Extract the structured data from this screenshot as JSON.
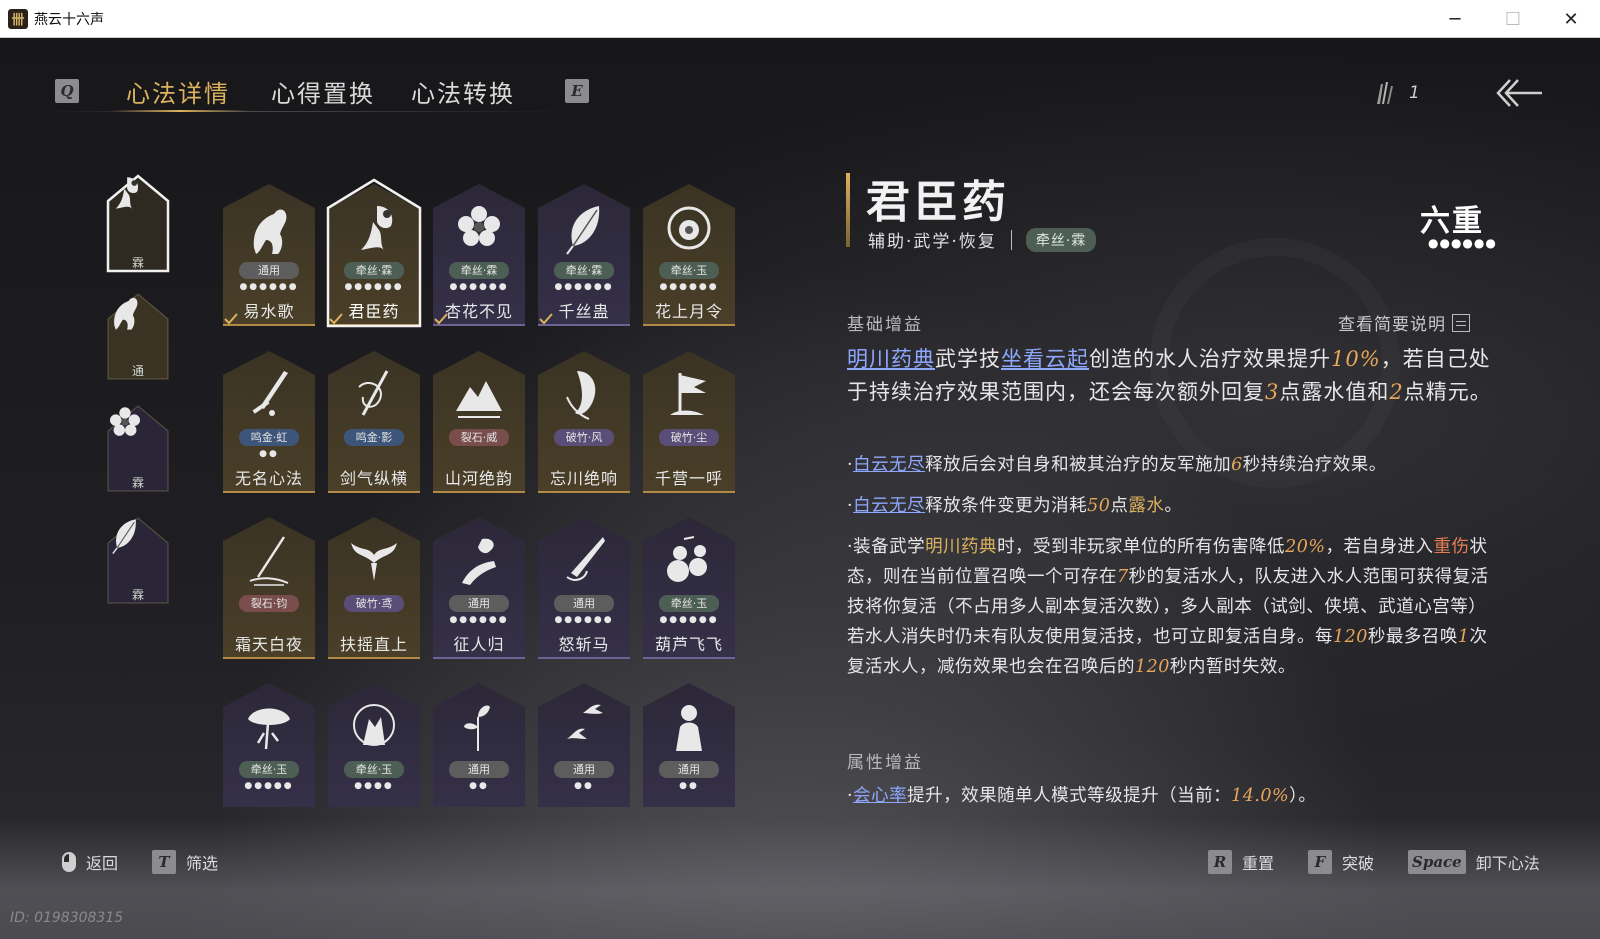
{
  "window": {
    "title": "燕云十六声",
    "icon_glyph": "卌",
    "minimize": "─",
    "maximize": "☐",
    "close": "✕"
  },
  "tabs": {
    "prev_key": "Q",
    "next_key": "E",
    "items": [
      {
        "label": "心法详情",
        "active": true
      },
      {
        "label": "心得置换",
        "active": false
      },
      {
        "label": "心法转换",
        "active": false
      }
    ]
  },
  "resource": {
    "icon": "feather-quill-icon",
    "count": "1"
  },
  "equipped": [
    {
      "icon": "water-pour-icon",
      "label": "霖"
    },
    {
      "icon": "horse-icon",
      "label": "通"
    },
    {
      "icon": "flower-icon",
      "label": "霖"
    },
    {
      "icon": "leaf-icon",
      "label": "霖"
    }
  ],
  "cards": [
    {
      "name": "易水歌",
      "tag": "通用",
      "dots": "●●●●●●",
      "tone": "gold",
      "tagColor": "#5d5d5d",
      "icon": "horse-icon",
      "check": true
    },
    {
      "name": "君臣药",
      "tag": "牵丝·霖",
      "dots": "●●●●●●",
      "tone": "gold",
      "tagColor": "#4d5f55",
      "icon": "water-pour-icon",
      "check": true,
      "selected": true
    },
    {
      "name": "杏花不见",
      "tag": "牵丝·霖",
      "dots": "●●●●●●",
      "tone": "purple",
      "tagColor": "#4d5f55",
      "icon": "flower-icon",
      "check": true
    },
    {
      "name": "千丝蛊",
      "tag": "牵丝·霖",
      "dots": "●●●●●●",
      "tone": "purple",
      "tagColor": "#4d5f55",
      "icon": "leaf-icon",
      "check": true
    },
    {
      "name": "花上月令",
      "tag": "牵丝·玉",
      "dots": "●●●●●●",
      "tone": "gold",
      "tagColor": "#4d5f55",
      "icon": "moon-flower-icon",
      "check": false
    },
    {
      "name": "无名心法",
      "tag": "鸣金·虹",
      "dots": "●●",
      "tone": "gold",
      "tagColor": "#3d5578",
      "icon": "sword-icon",
      "check": false
    },
    {
      "name": "剑气纵横",
      "tag": "鸣金·影",
      "dots": "",
      "tone": "gold",
      "tagColor": "#3d5578",
      "icon": "sword-swirl-icon",
      "check": false
    },
    {
      "name": "山河绝韵",
      "tag": "裂石·威",
      "dots": "",
      "tone": "gold",
      "tagColor": "#7a4d4d",
      "icon": "mountain-icon",
      "check": false
    },
    {
      "name": "忘川绝响",
      "tag": "破竹·风",
      "dots": "",
      "tone": "gold",
      "tagColor": "#5a4d78",
      "icon": "mask-icon",
      "check": false
    },
    {
      "name": "千营一呼",
      "tag": "破竹·尘",
      "dots": "",
      "tone": "gold",
      "tagColor": "#5a4d78",
      "icon": "banner-icon",
      "check": false
    },
    {
      "name": "霜天白夜",
      "tag": "裂石·钧",
      "dots": "",
      "tone": "gold",
      "tagColor": "#7a4d4d",
      "icon": "spear-icon",
      "check": false
    },
    {
      "name": "扶摇直上",
      "tag": "破竹·鸢",
      "dots": "",
      "tone": "gold",
      "tagColor": "#5a4d78",
      "icon": "eagle-icon",
      "check": false
    },
    {
      "name": "征人归",
      "tag": "通用",
      "dots": "●●●●●●",
      "tone": "purple",
      "tagColor": "#5d5d5d",
      "icon": "hand-bird-icon",
      "check": false
    },
    {
      "name": "怒斩马",
      "tag": "通用",
      "dots": "●●●●●●",
      "tone": "purple",
      "tagColor": "#5d5d5d",
      "icon": "blade-icon",
      "check": false
    },
    {
      "name": "葫芦飞飞",
      "tag": "牵丝·玉",
      "dots": "●●●●●●",
      "tone": "purple",
      "tagColor": "#4d5f55",
      "icon": "gourd-icon",
      "check": false
    },
    {
      "name": "",
      "tag": "牵丝·玉",
      "dots": "●●●●●",
      "tone": "purple",
      "tagColor": "#4d5f55",
      "icon": "storm-tree-icon",
      "check": false
    },
    {
      "name": "",
      "tag": "牵丝·玉",
      "dots": "●●●●",
      "tone": "purple",
      "tagColor": "#4d5f55",
      "icon": "wolf-moon-icon",
      "check": false
    },
    {
      "name": "",
      "tag": "通用",
      "dots": "●●",
      "tone": "purple",
      "tagColor": "#5d5d5d",
      "icon": "sprout-icon",
      "check": false
    },
    {
      "name": "",
      "tag": "通用",
      "dots": "●●",
      "tone": "purple",
      "tagColor": "#5d5d5d",
      "icon": "swallows-icon",
      "check": false
    },
    {
      "name": "",
      "tag": "通用",
      "dots": "●●",
      "tone": "purple",
      "tagColor": "#5d5d5d",
      "icon": "figure-icon",
      "check": false
    }
  ],
  "detail": {
    "name": "君臣药",
    "categories": "辅助·武学·恢复",
    "school": "牵丝·霖",
    "rank": "六重",
    "rank_dots": "●●●●●●",
    "base_title": "基础增益",
    "brief_label": "查看简要说明",
    "main_p1_link1": "明川药典",
    "main_p1_t1": "武学技",
    "main_p1_link2": "坐看云起",
    "main_p1_t2": "创造的水人治疗效果提升",
    "main_p1_v1": "10%",
    "main_p1_t3": "，若自己处于持续治疗效果范围内，还会每次额外回复",
    "main_p1_v2": "3",
    "main_p1_t4": "点露水值和",
    "main_p1_v3": "2",
    "main_p1_t5": "点精元。",
    "b1_prefix": "·",
    "b1_link": "白云无尽",
    "b1_t1": "释放后会对自身和被其治疗的友军施加",
    "b1_v1": "6",
    "b1_t2": "秒持续治疗效果。",
    "b2_prefix": "·",
    "b2_link": "白云无尽",
    "b2_t1": "释放条件变更为消耗",
    "b2_v1": "50",
    "b2_t2": "点",
    "b2_kw": "露水",
    "b2_t3": "。",
    "b3_t1": "·装备武学",
    "b3_kw1": "明川药典",
    "b3_t2": "时，受到非玩家单位的所有伤害降低",
    "b3_v1": "20%",
    "b3_t3": "，若自身进入",
    "b3_kw2": "重伤",
    "b3_t4": "状态，则在当前位置召唤一个可存在",
    "b3_v2": "7",
    "b3_t5": "秒的复活水人，队友进入水人范围可获得复活技将你复活（不占用多人副本复活次数），多人副本（试剑、侠境、武道心宫等）若水人消失时仍未有队友使用复活技，也可立即复活自身。每",
    "b3_v3": "120",
    "b3_t6": "秒最多召唤",
    "b3_v4": "1",
    "b3_t7": "次复活水人，减伤效果也会在召唤后的",
    "b3_v5": "120",
    "b3_t8": "秒内暂时失效。",
    "attr_title": "属性增益",
    "attr_prefix": "·",
    "attr_link": "会心率",
    "attr_t1": "提升，效果随单人模式等级提升（当前：",
    "attr_v1": "14.0%",
    "attr_t2": "）。"
  },
  "bottom": {
    "back_label": "返回",
    "filter_key": "T",
    "filter_label": "筛选",
    "reset_key": "R",
    "reset_label": "重置",
    "breakthrough_key": "F",
    "breakthrough_label": "突破",
    "unequip_key": "Space",
    "unequip_label": "卸下心法",
    "user_id": "ID: 0198308315"
  },
  "colors": {
    "gold": "#dcb25e",
    "link": "#8fa8ff",
    "value": "#e8a65a"
  }
}
